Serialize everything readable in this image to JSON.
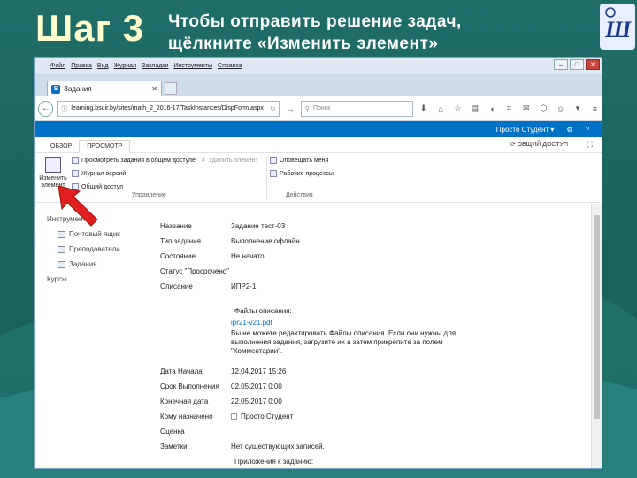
{
  "slide": {
    "title": "Шаг 3",
    "subtitle_line1": "Чтобы отправить решение задач,",
    "subtitle_line2": "щёлкните «Изменить элемент»"
  },
  "browser": {
    "menu": [
      "Файл",
      "Правка",
      "Вид",
      "Журнал",
      "Закладки",
      "Инструменты",
      "Справка"
    ],
    "tab_title": "Задания",
    "url": "learning.bsuir.by/sites/math_2_2016-17/TaskInstances/DispForm.aspx",
    "search_placeholder": "Поиск"
  },
  "suite": {
    "user": "Просто Студент ▾"
  },
  "ribbon": {
    "tabs": [
      "ОБЗОР",
      "ПРОСМОТР"
    ],
    "share": "ОБЩИЙ ДОСТУП",
    "edit_item": "Изменить элемент",
    "view_shared": "Просмотреть задания в общем доступе",
    "delete_item": "Удалить элемент",
    "version_log": "Журнал версий",
    "shared_access": "Общий доступ",
    "alert_me": "Оповещать меня",
    "workflows": "Рабочие процессы",
    "group_manage": "Управление",
    "group_actions": "Действия"
  },
  "leftnav": {
    "heading": "Инструменты",
    "items": [
      "Почтовый ящик",
      "Преподаватели",
      "Задания"
    ],
    "courses": "Курсы"
  },
  "form": {
    "name_label": "Название",
    "name_value": "Задание тест-03",
    "type_label": "Тип задания",
    "type_value": "Выполнение офлайн",
    "state_label": "Состояние",
    "state_value": "Не начато",
    "overdue_label": "Статус \"Просрочено\"",
    "desc_label": "Описание",
    "desc_value": "ИПР2-1",
    "files_heading": "Файлы описания:",
    "file_link": "ipr21-v21.pdf",
    "files_note": "Вы не можете редактировать Файлы описания. Если они нужны для выполнения задания, загрузите их а затем прикрепите за полем \"Комментарии\".",
    "start_label": "Дата Начала",
    "start_value": "12.04.2017 15:26",
    "due_label": "Срок Выполнения",
    "due_value": "02.05.2017 0:00",
    "end_label": "Конечная дата",
    "end_value": "22.05.2017 0:00",
    "assigned_label": "Кому назначено",
    "assigned_value": "Просто Студент",
    "grade_label": "Оценка",
    "notes_label": "Заметки",
    "notes_value": "Нет существующих записей.",
    "attachments_heading": "Приложения к заданию:"
  },
  "colors": {
    "suite_bar": "#0072c6",
    "accent_arrow": "#e0201c",
    "title_yellow": "#ffffcc"
  }
}
